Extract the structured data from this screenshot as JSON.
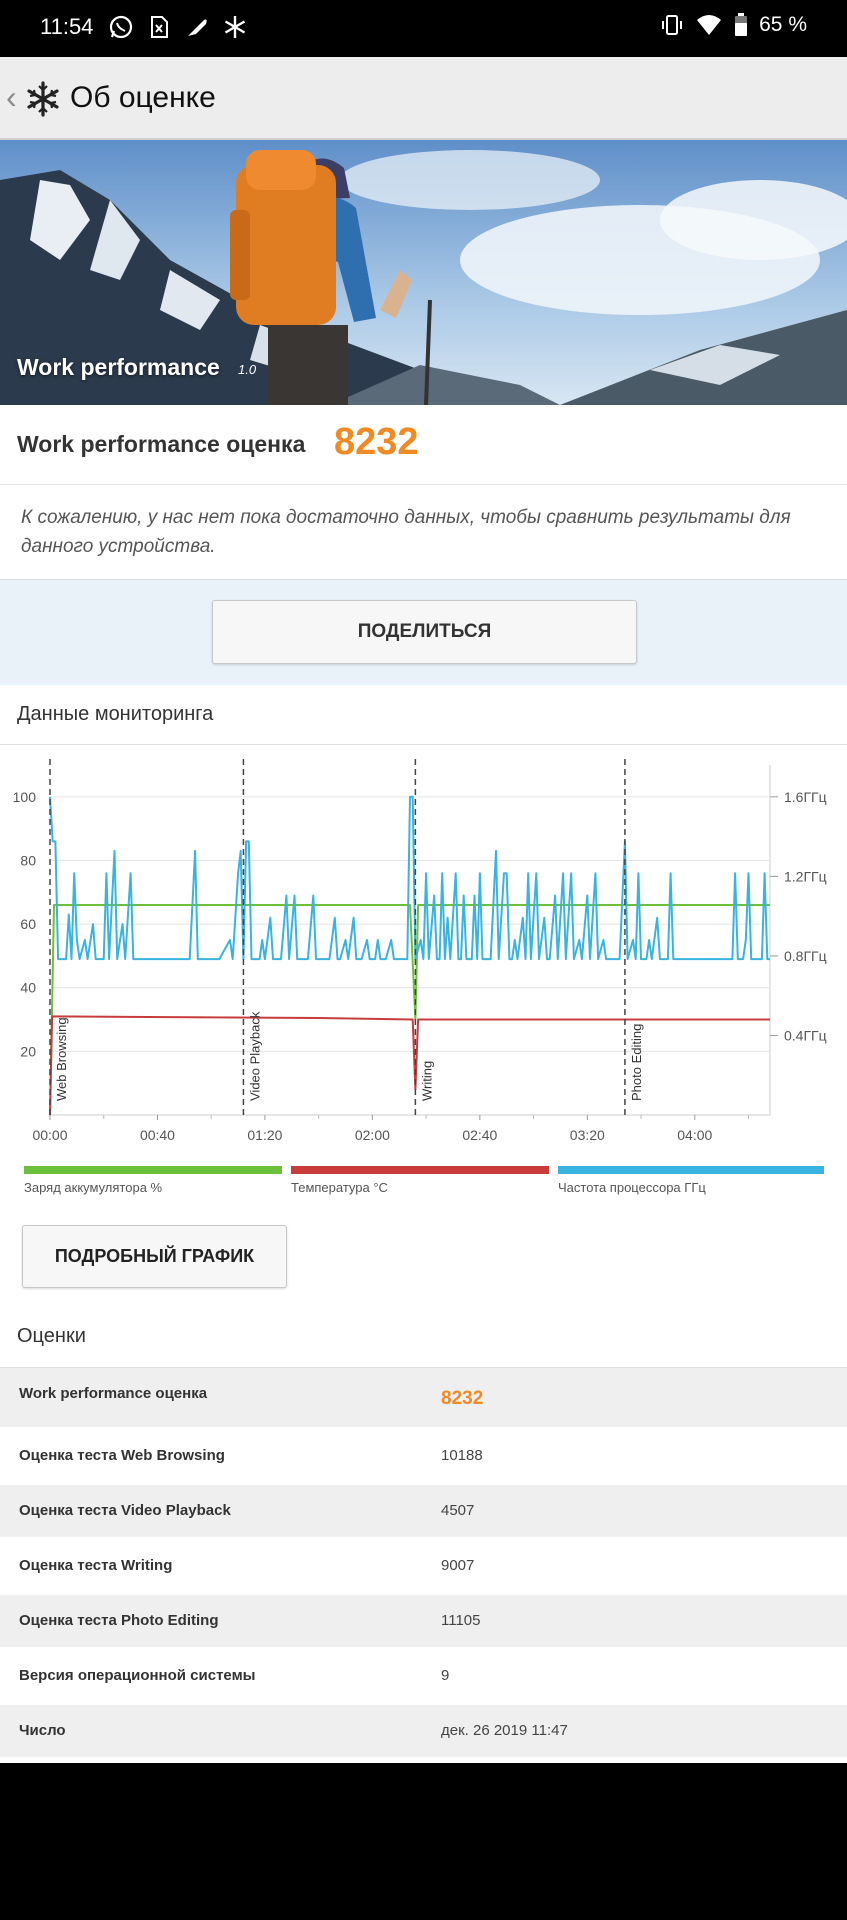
{
  "status_bar": {
    "time": "11:54",
    "battery": "65 %"
  },
  "app_bar": {
    "title": "Об оценке",
    "back_icon": "chevron-left-icon",
    "logo_icon": "snowflake-logo-icon"
  },
  "hero": {
    "title": "Work performance",
    "version": "1.0"
  },
  "score": {
    "label": "Work performance оценка",
    "value": "8232"
  },
  "note": "К сожалению, у нас нет пока достаточно данных, чтобы сравнить результаты для данного устройства.",
  "share_button": "ПОДЕЛИТЬСЯ",
  "monitoring": {
    "title": "Данные мониторинга"
  },
  "chart_data": {
    "type": "line",
    "x_ticks": [
      "00:00",
      "00:40",
      "01:20",
      "02:00",
      "02:40",
      "03:20",
      "04:00"
    ],
    "x_range_seconds": [
      0,
      268
    ],
    "y_left_ticks": [
      "20",
      "40",
      "60",
      "80",
      "100"
    ],
    "y_left_range": [
      0,
      110
    ],
    "y_right_ticks": [
      "0.4ГГц",
      "0.8ГГц",
      "1.2ГГц",
      "1.6ГГц"
    ],
    "grid": true,
    "markers": [
      {
        "label": "Web Browsing",
        "t": 0
      },
      {
        "label": "Video Playback",
        "t": 72
      },
      {
        "label": "Writing",
        "t": 136
      },
      {
        "label": "Photo Editing",
        "t": 214
      }
    ],
    "series": [
      {
        "name": "Заряд аккумулятора %",
        "color": "#6cc03a",
        "points": [
          [
            0,
            0
          ],
          [
            1.5,
            66
          ],
          [
            134,
            66
          ],
          [
            136,
            30
          ],
          [
            137,
            66
          ],
          [
            268,
            66
          ]
        ]
      },
      {
        "name": "Температура °C",
        "color": "#c83c3c",
        "points": [
          [
            0,
            0
          ],
          [
            0.8,
            31
          ],
          [
            100,
            30.5
          ],
          [
            135,
            30
          ],
          [
            136,
            8
          ],
          [
            137,
            30
          ],
          [
            268,
            30
          ]
        ]
      },
      {
        "name": "Частота процессора ГГц",
        "color": "#39b3df",
        "points": [
          [
            0,
            100
          ],
          [
            1,
            86
          ],
          [
            2,
            86
          ],
          [
            3,
            49
          ],
          [
            6,
            49
          ],
          [
            7,
            63
          ],
          [
            8,
            49
          ],
          [
            9,
            76
          ],
          [
            10,
            55
          ],
          [
            11,
            49
          ],
          [
            13,
            55
          ],
          [
            14,
            49
          ],
          [
            16,
            60
          ],
          [
            17,
            49
          ],
          [
            20,
            49
          ],
          [
            21,
            76
          ],
          [
            22,
            49
          ],
          [
            24,
            83
          ],
          [
            25,
            49
          ],
          [
            27,
            60
          ],
          [
            28,
            49
          ],
          [
            30,
            76
          ],
          [
            31,
            49
          ],
          [
            32,
            49
          ],
          [
            36,
            49
          ],
          [
            37,
            49
          ],
          [
            40,
            49
          ],
          [
            44,
            49
          ],
          [
            48,
            49
          ],
          [
            52,
            49
          ],
          [
            54,
            83
          ],
          [
            55,
            49
          ],
          [
            60,
            49
          ],
          [
            63,
            49
          ],
          [
            67,
            55
          ],
          [
            68,
            49
          ],
          [
            70,
            76
          ],
          [
            71,
            83
          ],
          [
            72,
            49
          ],
          [
            73,
            86
          ],
          [
            74,
            86
          ],
          [
            75,
            49
          ],
          [
            78,
            49
          ],
          [
            79,
            55
          ],
          [
            80,
            49
          ],
          [
            82,
            62
          ],
          [
            83,
            49
          ],
          [
            84,
            49
          ],
          [
            86,
            49
          ],
          [
            88,
            69
          ],
          [
            89,
            49
          ],
          [
            91,
            69
          ],
          [
            92,
            49
          ],
          [
            94,
            49
          ],
          [
            96,
            49
          ],
          [
            98,
            69
          ],
          [
            99,
            49
          ],
          [
            102,
            49
          ],
          [
            104,
            49
          ],
          [
            106,
            62
          ],
          [
            107,
            49
          ],
          [
            108,
            49
          ],
          [
            110,
            55
          ],
          [
            111,
            49
          ],
          [
            113,
            62
          ],
          [
            114,
            49
          ],
          [
            116,
            49
          ],
          [
            118,
            55
          ],
          [
            119,
            49
          ],
          [
            121,
            49
          ],
          [
            122,
            55
          ],
          [
            123,
            49
          ],
          [
            125,
            49
          ],
          [
            127,
            55
          ],
          [
            128,
            49
          ],
          [
            130,
            49
          ],
          [
            131,
            49
          ],
          [
            133,
            49
          ],
          [
            134,
            100
          ],
          [
            135,
            100
          ],
          [
            136,
            49
          ],
          [
            138,
            55
          ],
          [
            139,
            49
          ],
          [
            140,
            76
          ],
          [
            141,
            49
          ],
          [
            143,
            69
          ],
          [
            144,
            49
          ],
          [
            145,
            49
          ],
          [
            146,
            76
          ],
          [
            147,
            49
          ],
          [
            148,
            62
          ],
          [
            149,
            49
          ],
          [
            151,
            76
          ],
          [
            152,
            49
          ],
          [
            153,
            49
          ],
          [
            154,
            69
          ],
          [
            155,
            49
          ],
          [
            157,
            49
          ],
          [
            158,
            69
          ],
          [
            159,
            49
          ],
          [
            160,
            76
          ],
          [
            161,
            49
          ],
          [
            164,
            49
          ],
          [
            166,
            83
          ],
          [
            167,
            49
          ],
          [
            169,
            76
          ],
          [
            170,
            76
          ],
          [
            171,
            49
          ],
          [
            172,
            49
          ],
          [
            173,
            55
          ],
          [
            174,
            49
          ],
          [
            176,
            62
          ],
          [
            177,
            49
          ],
          [
            178,
            76
          ],
          [
            179,
            49
          ],
          [
            181,
            76
          ],
          [
            182,
            49
          ],
          [
            184,
            62
          ],
          [
            185,
            49
          ],
          [
            186,
            49
          ],
          [
            188,
            69
          ],
          [
            189,
            49
          ],
          [
            191,
            76
          ],
          [
            192,
            49
          ],
          [
            194,
            76
          ],
          [
            195,
            49
          ],
          [
            197,
            55
          ],
          [
            198,
            49
          ],
          [
            200,
            69
          ],
          [
            201,
            49
          ],
          [
            203,
            76
          ],
          [
            204,
            49
          ],
          [
            206,
            55
          ],
          [
            207,
            49
          ],
          [
            212,
            49
          ],
          [
            214,
            86
          ],
          [
            215,
            49
          ],
          [
            217,
            55
          ],
          [
            218,
            49
          ],
          [
            219,
            76
          ],
          [
            220,
            49
          ],
          [
            222,
            49
          ],
          [
            223,
            55
          ],
          [
            224,
            49
          ],
          [
            226,
            62
          ],
          [
            227,
            49
          ],
          [
            230,
            49
          ],
          [
            231,
            76
          ],
          [
            232,
            49
          ],
          [
            240,
            49
          ],
          [
            250,
            49
          ],
          [
            254,
            49
          ],
          [
            255,
            76
          ],
          [
            256,
            49
          ],
          [
            258,
            49
          ],
          [
            259,
            55
          ],
          [
            260,
            76
          ],
          [
            261,
            49
          ],
          [
            263,
            49
          ],
          [
            265,
            49
          ],
          [
            266,
            76
          ],
          [
            267,
            49
          ],
          [
            268,
            49
          ]
        ]
      }
    ]
  },
  "legend": [
    {
      "label": "Заряд аккумулятора %",
      "color": "#6cc03a"
    },
    {
      "label": "Температура °C",
      "color": "#c83c3c"
    },
    {
      "label": "Частота процессора ГГц",
      "color": "#39b3df"
    }
  ],
  "detail_button": "ПОДРОБНЫЙ ГРАФИК",
  "scores": {
    "title": "Оценки",
    "rows": [
      {
        "key": "Work performance оценка",
        "value": "8232"
      },
      {
        "key": "Оценка теста Web Browsing",
        "value": "10188"
      },
      {
        "key": "Оценка теста Video Playback",
        "value": "4507"
      },
      {
        "key": "Оценка теста Writing",
        "value": "9007"
      },
      {
        "key": "Оценка теста Photo Editing",
        "value": "11105"
      },
      {
        "key": "Версия операционной системы",
        "value": "9"
      },
      {
        "key": "Число",
        "value": "дек. 26 2019 11:47"
      }
    ]
  }
}
